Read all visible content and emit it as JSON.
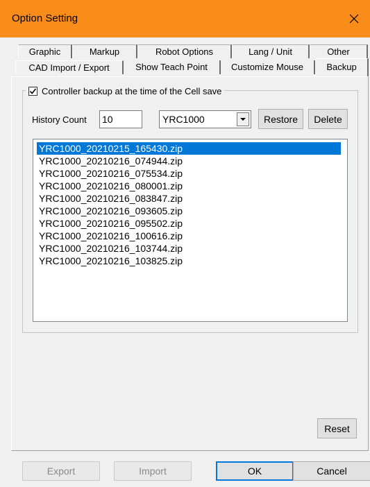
{
  "window": {
    "title": "Option Setting"
  },
  "tabs": {
    "row1": [
      "Graphic",
      "Markup",
      "Robot Options",
      "Lang / Unit",
      "Other"
    ],
    "row2": [
      "CAD Import / Export",
      "Show Teach Point",
      "Customize Mouse",
      "Backup"
    ],
    "active": "Backup"
  },
  "backup": {
    "group_label": "Controller backup at the time of the Cell save",
    "group_checked": true,
    "history_count_label": "History Count",
    "history_count_value": "10",
    "controller_selected": "YRC1000",
    "restore_label": "Restore",
    "delete_label": "Delete",
    "files": [
      "YRC1000_20210215_165430.zip",
      "YRC1000_20210216_074944.zip",
      "YRC1000_20210216_075534.zip",
      "YRC1000_20210216_080001.zip",
      "YRC1000_20210216_083847.zip",
      "YRC1000_20210216_093605.zip",
      "YRC1000_20210216_095502.zip",
      "YRC1000_20210216_100616.zip",
      "YRC1000_20210216_103744.zip",
      "YRC1000_20210216_103825.zip"
    ],
    "selected_index": 0,
    "reset_label": "Reset"
  },
  "footer": {
    "export_label": "Export",
    "import_label": "Import",
    "ok_label": "OK",
    "cancel_label": "Cancel"
  },
  "colors": {
    "titlebar": "#fa8c1a",
    "selection": "#0078d7"
  }
}
